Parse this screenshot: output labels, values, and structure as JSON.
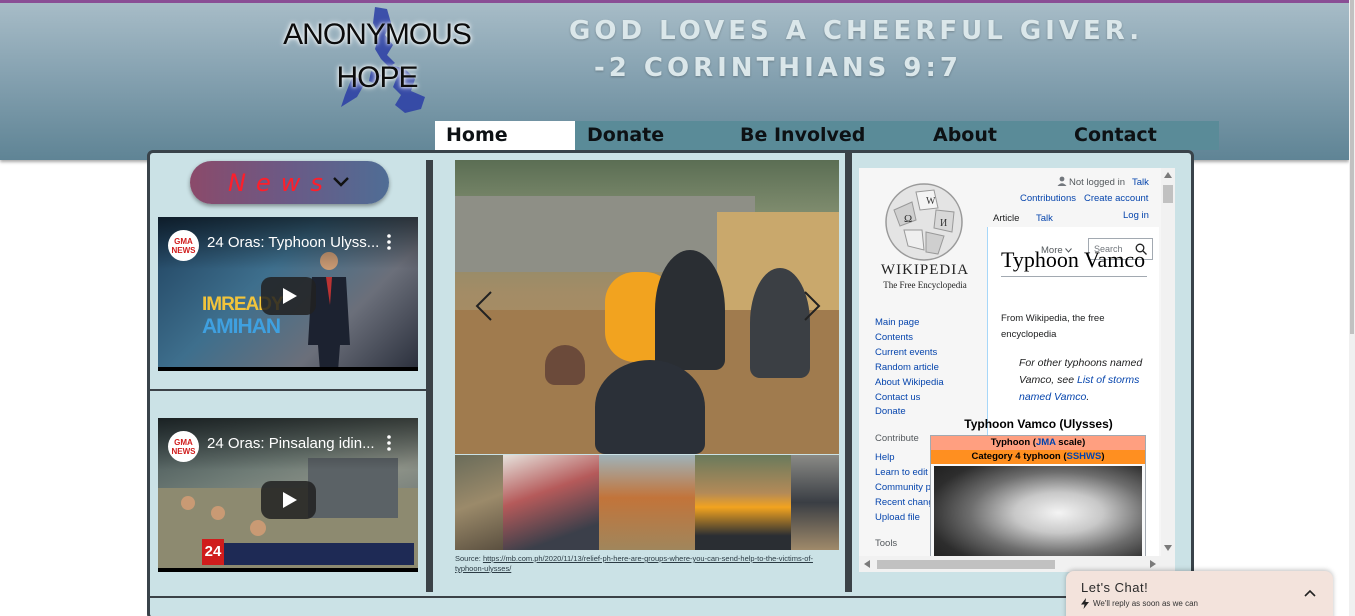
{
  "site": {
    "logo_line1": "ANONYMOUS",
    "logo_line2": "HOPE",
    "quote_line1": "GOD LOVES A CHEERFUL GIVER.",
    "quote_line2": "-2 CORINTHIANS 9:7"
  },
  "nav": [
    {
      "label": "Home",
      "active": true
    },
    {
      "label": "Donate",
      "active": false
    },
    {
      "label": "Be Involved",
      "active": false
    },
    {
      "label": "About",
      "active": false
    },
    {
      "label": "Contact",
      "active": false
    }
  ],
  "news": {
    "label": "News",
    "icon": "chevron-down-icon"
  },
  "videos": [
    {
      "channel": "GMA NEWS",
      "title": "24 Oras: Typhoon Ulyss...",
      "overlay_1": "IMREADY",
      "overlay_2": "AMIHAN"
    },
    {
      "channel": "GMA NEWS",
      "title": "24 Oras: Pinsalang idin...",
      "badge": "24"
    }
  ],
  "gallery": {
    "prev_icon": "chevron-left-icon",
    "next_icon": "chevron-right-icon",
    "source_prefix": "Source: ",
    "source_url": "https://mb.com.ph/2020/11/13/relief-ph-here-are-groups-where-you-can-send-help-to-the-victims-of-typhoon-ulysses/"
  },
  "wikipedia": {
    "wordmark": "WIKIPEDIA",
    "tagline": "The Free Encyclopedia",
    "not_logged_in": "Not logged in",
    "talk_top": "Talk",
    "contributions": "Contributions",
    "create_account": "Create account",
    "log_in": "Log in",
    "tab_article": "Article",
    "tab_talk": "Talk",
    "more": "More",
    "search_placeholder": "Search",
    "nav_links": [
      "Main page",
      "Contents",
      "Current events",
      "Random article",
      "About Wikipedia",
      "Contact us",
      "Donate"
    ],
    "contribute_heading": "Contribute",
    "contribute_links": [
      "Help",
      "Learn to edit",
      "Community portal",
      "Recent changes",
      "Upload file"
    ],
    "tools_heading": "Tools",
    "article_title": "Typhoon Vamco",
    "from_line": "From Wikipedia, the free encyclopedia",
    "hatnote_prefix": "For other typhoons named Vamco, see ",
    "hatnote_link": "List of storms named Vamco",
    "hatnote_suffix": ".",
    "infobox_title": "Typhoon Vamco (Ulysses)",
    "infobox_row1_prefix": "Typhoon (",
    "infobox_row1_link": "JMA",
    "infobox_row1_suffix": " scale)",
    "infobox_row2_prefix": "Category 4 typhoon (",
    "infobox_row2_link": "SSHWS",
    "infobox_row2_suffix": ")"
  },
  "chat": {
    "title": "Let's Chat!",
    "subtitle": "We'll reply as soon as we can"
  },
  "colors": {
    "header_top": "#a7bcc7",
    "header_bottom": "#5f8495",
    "nav_bar": "#5a8b98",
    "panel": "#cbe2e6",
    "news_text": "#ff1e2a",
    "link": "#0645ad"
  }
}
